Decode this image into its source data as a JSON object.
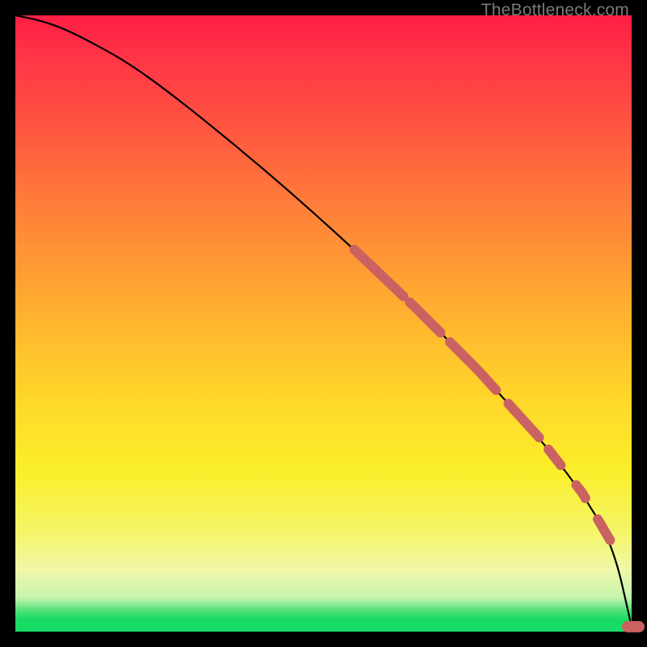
{
  "watermark": "TheBottleneck.com",
  "chart_data": {
    "type": "line",
    "title": "",
    "xlabel": "",
    "ylabel": "",
    "xlim": [
      0,
      100
    ],
    "ylim": [
      0,
      100
    ],
    "curve": {
      "name": "bottleneck-curve",
      "x": [
        0,
        4,
        8,
        12,
        18,
        25,
        35,
        45,
        55,
        65,
        75,
        85,
        92,
        97,
        100
      ],
      "y": [
        100,
        99.2,
        97.8,
        95.8,
        92.5,
        87.5,
        79.5,
        71.0,
        62.0,
        52.5,
        42.5,
        31.5,
        22.5,
        14.0,
        0.8
      ]
    },
    "highlight_segments": [
      {
        "x_start": 55,
        "x_end": 63
      },
      {
        "x_start": 64,
        "x_end": 69
      },
      {
        "x_start": 70.5,
        "x_end": 78
      },
      {
        "x_start": 80,
        "x_end": 85
      },
      {
        "x_start": 86.5,
        "x_end": 88.5
      },
      {
        "x_start": 91,
        "x_end": 92.5
      },
      {
        "x_start": 94.5,
        "x_end": 96.5
      }
    ],
    "end_marker": {
      "x": 100,
      "y": 0.8
    },
    "highlight_color": "#cb6262",
    "highlight_width": 12,
    "curve_color": "#000000"
  }
}
